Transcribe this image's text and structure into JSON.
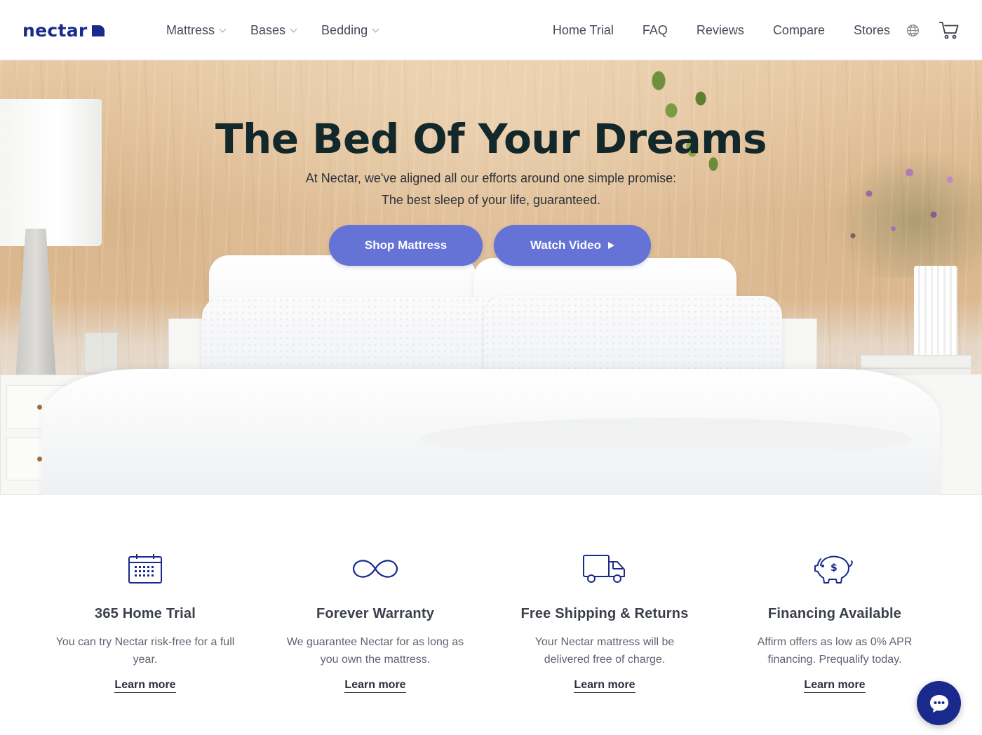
{
  "brand": {
    "name": "nectar"
  },
  "nav": {
    "left": [
      {
        "label": "Mattress"
      },
      {
        "label": "Bases"
      },
      {
        "label": "Bedding"
      }
    ],
    "right": [
      {
        "label": "Home Trial"
      },
      {
        "label": "FAQ"
      },
      {
        "label": "Reviews"
      },
      {
        "label": "Compare"
      },
      {
        "label": "Stores"
      }
    ],
    "icons": [
      "globe-icon",
      "cart-icon"
    ]
  },
  "hero": {
    "title": "The Bed Of Your Dreams",
    "subtitle_line1": "At Nectar, we've aligned all our efforts around one simple promise:",
    "subtitle_line2": "The best sleep of your life, guaranteed.",
    "primary_button": "Shop Mattress",
    "secondary_button": "Watch Video",
    "button_color": "#6572d6"
  },
  "features": [
    {
      "icon": "calendar-icon",
      "title": "365 Home Trial",
      "description": "You can try Nectar risk-free for a full year.",
      "link": "Learn more"
    },
    {
      "icon": "infinity-icon",
      "title": "Forever Warranty",
      "description": "We guarantee Nectar for as long as you own the mattress.",
      "link": "Learn more"
    },
    {
      "icon": "truck-icon",
      "title": "Free Shipping & Returns",
      "description": "Your Nectar mattress will be delivered free of charge.",
      "link": "Learn more"
    },
    {
      "icon": "piggy-bank-icon",
      "title": "Financing Available",
      "description": "Affirm offers as low as 0% APR financing. Prequalify today.",
      "link": "Learn more"
    }
  ],
  "chat": {
    "icon": "chat-bubble-icon"
  },
  "colors": {
    "brand": "#1a2a8c",
    "accent": "#6572d6",
    "title": "#13282a"
  }
}
